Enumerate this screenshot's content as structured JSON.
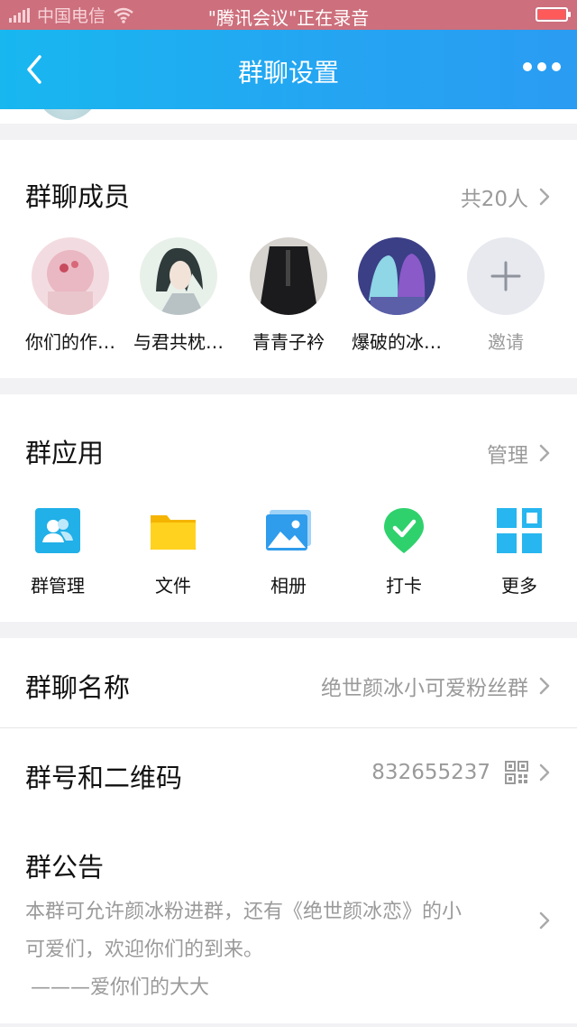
{
  "status_bar": {
    "carrier": "中国电信",
    "notice": "\"腾讯会议\"正在录音"
  },
  "nav": {
    "title": "群聊设置",
    "back_icon": "chevron-left-icon",
    "more_icon": "more-dots-icon"
  },
  "members": {
    "title": "群聊成员",
    "count": "共20人",
    "items": [
      {
        "name": "你们的作…",
        "avatar": "avatar-pink"
      },
      {
        "name": "与君共枕…",
        "avatar": "avatar-anime-boy"
      },
      {
        "name": "青青子衿",
        "avatar": "avatar-suit"
      },
      {
        "name": "爆破的冰…",
        "avatar": "avatar-game-girls"
      }
    ],
    "invite_label": "邀请"
  },
  "apps": {
    "title": "群应用",
    "manage": "管理",
    "items": [
      {
        "label": "群管理",
        "icon": "group-manage-icon"
      },
      {
        "label": "文件",
        "icon": "folder-icon"
      },
      {
        "label": "相册",
        "icon": "album-icon"
      },
      {
        "label": "打卡",
        "icon": "checkin-icon"
      },
      {
        "label": "更多",
        "icon": "grid-more-icon"
      }
    ]
  },
  "group_name": {
    "label": "群聊名称",
    "value": "绝世颜冰小可爱粉丝群"
  },
  "group_id": {
    "label": "群号和二维码",
    "value": "832655237",
    "icon": "qrcode-icon"
  },
  "announcement": {
    "label": "群公告",
    "line1": "本群可允许颜冰粉进群，还有《绝世颜冰恋》的小",
    "line2": "可爱们，欢迎你们的到来。",
    "line3": "———爱你们的大大"
  },
  "colors": {
    "nav_start": "#18b7f0",
    "nav_end": "#2a9cf2",
    "status_bar": "#cd6f7c",
    "grey_text": "#9a9a9a"
  }
}
